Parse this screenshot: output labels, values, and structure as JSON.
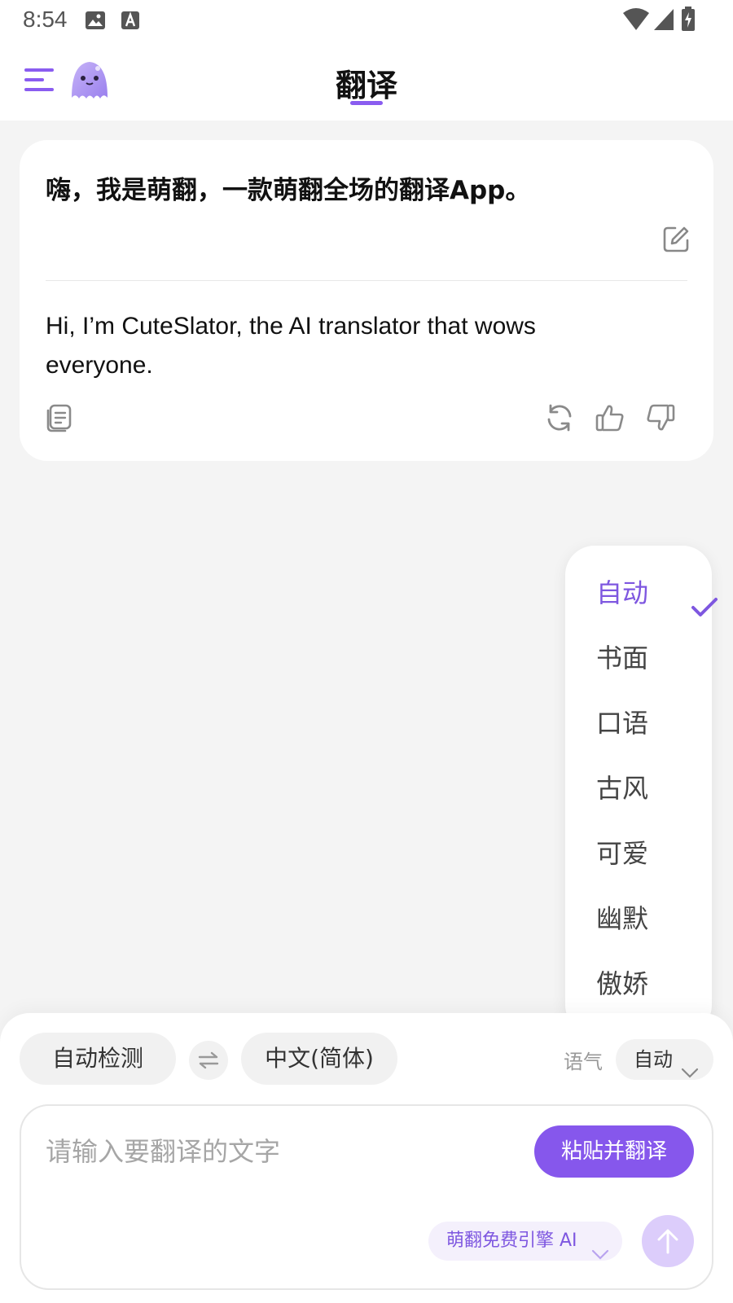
{
  "status_bar": {
    "time": "8:54",
    "icons": [
      "image-icon",
      "text-a-icon",
      "wifi-icon",
      "signal-icon",
      "battery-charging-icon"
    ]
  },
  "header": {
    "title": "翻译",
    "menu_icon": "menu-icon",
    "logo_icon": "ghost-mascot-icon",
    "accent_color": "#8a5cf0"
  },
  "card": {
    "source_text": "嗨，我是萌翻，一款萌翻全场的翻译App。",
    "target_text": "Hi, I’m CuteSlator, the AI translator that wows everyone.",
    "icons": [
      "edit-icon",
      "copy-icon",
      "refresh-icon",
      "thumbs-up-icon",
      "thumbs-down-icon"
    ]
  },
  "tone_dropdown": {
    "items": [
      {
        "label": "自动",
        "selected": true
      },
      {
        "label": "书面",
        "selected": false
      },
      {
        "label": "口语",
        "selected": false
      },
      {
        "label": "古风",
        "selected": false
      },
      {
        "label": "可爱",
        "selected": false
      },
      {
        "label": "幽默",
        "selected": false
      },
      {
        "label": "傲娇",
        "selected": false
      }
    ],
    "selected_color": "#7e57e0"
  },
  "bottom": {
    "source_lang": "自动检测",
    "target_lang": "中文(简体)",
    "tone_label": "语气",
    "tone_value": "自动",
    "input_placeholder": "请输入要翻译的文字",
    "input_value": "",
    "paste_button": "粘贴并翻译",
    "engine_label": "萌翻免费引擎 AI",
    "button_color": "#8657ec"
  }
}
